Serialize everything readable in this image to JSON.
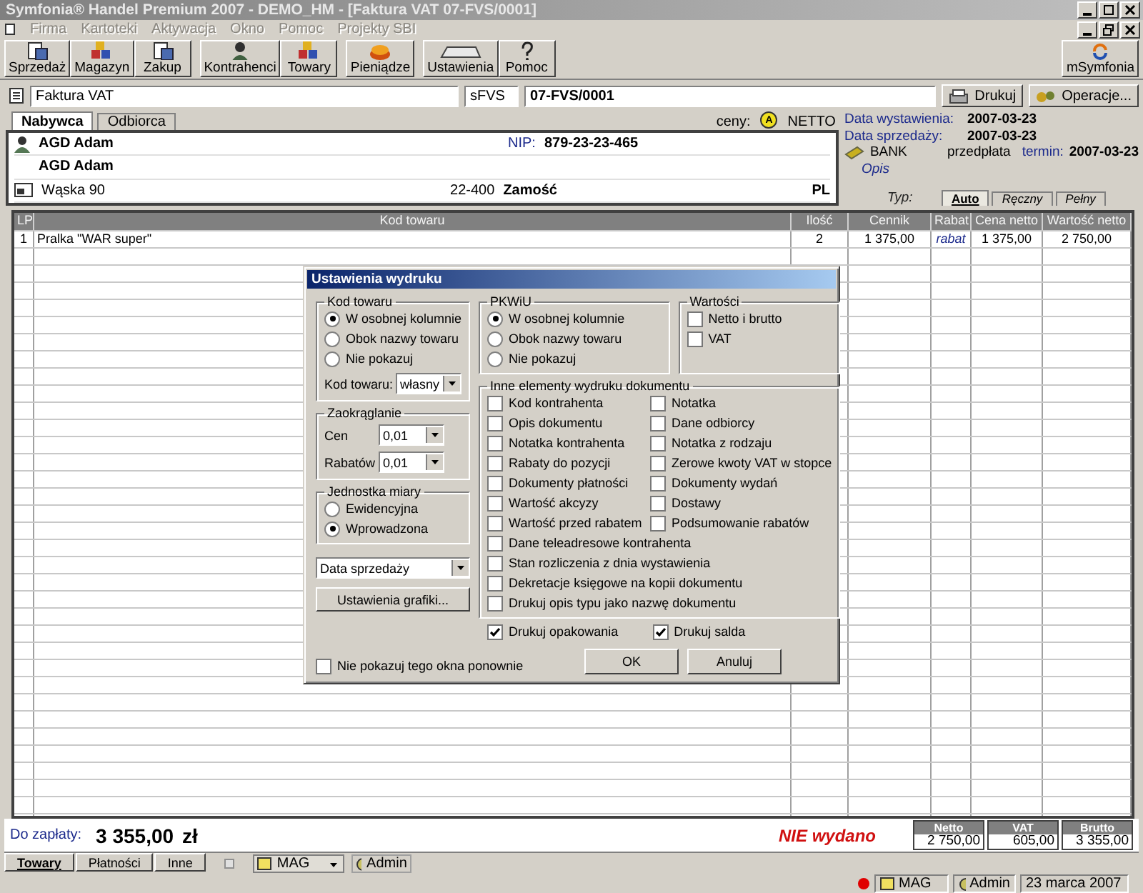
{
  "window": {
    "title": "Symfonia® Handel Premium 2007 - DEMO_HM - [Faktura VAT 07-FVS/0001]"
  },
  "menu": [
    {
      "label": "Firma",
      "disabled": true
    },
    {
      "label": "Kartoteki",
      "disabled": true
    },
    {
      "label": "Aktywacja",
      "disabled": true
    },
    {
      "label": "Okno",
      "disabled": true
    },
    {
      "label": "Pomoc",
      "disabled": true
    },
    {
      "label": "Projekty SBI",
      "disabled": true
    }
  ],
  "toolbar_groups": [
    [
      "Sprzedaż",
      "Magazyn",
      "Zakup"
    ],
    [
      "Kontrahenci",
      "Towary"
    ],
    [
      "Pieniądze"
    ],
    [
      "Ustawienia",
      "Pomoc"
    ]
  ],
  "toolbar_right": "mSymfonia",
  "document": {
    "type": "Faktura VAT",
    "series": "sFVS",
    "number": "07-FVS/0001",
    "print": "Drukuj",
    "operations": "Operacje..."
  },
  "party_tabs": [
    {
      "label": "Nabywca",
      "selected": true
    },
    {
      "label": "Odbiorca",
      "selected": false
    }
  ],
  "prices": {
    "label": "ceny:",
    "badge": "A",
    "mode": "NETTO"
  },
  "customer": {
    "name": "AGD Adam",
    "nip_label": "NIP:",
    "nip": "879-23-23-465",
    "name2": "AGD Adam",
    "street": "Wąska 90",
    "postcode": "22-400",
    "city": "Zamość",
    "country": "PL"
  },
  "dates": [
    {
      "label": "Data wystawienia:",
      "value": "2007-03-23"
    },
    {
      "label": "Data sprzedaży:",
      "value": "2007-03-23"
    }
  ],
  "payment": {
    "method": "BANK",
    "kind": "przedpłata",
    "term_label": "termin:",
    "term": "2007-03-23"
  },
  "description_label": "Opis",
  "type_label": "Typ:",
  "type_tabs": [
    {
      "label": "Auto",
      "selected": true
    },
    {
      "label": "Ręczny",
      "selected": false
    },
    {
      "label": "Pełny",
      "selected": false
    }
  ],
  "table": {
    "columns": [
      "LP",
      "Kod towaru",
      "Ilość",
      "Cennik",
      "Rabat",
      "Cena netto",
      "Wartość netto"
    ],
    "rows": [
      [
        "1",
        "Pralka \"WAR super\"",
        "2",
        "1 375,00",
        "rabat",
        "1 375,00",
        "2 750,00"
      ]
    ]
  },
  "footer": {
    "due_label": "Do zapłaty:",
    "amount": "3 355,00",
    "currency": "zł",
    "status": "NIE wydano",
    "totals": [
      {
        "label": "Netto",
        "value": "2 750,00"
      },
      {
        "label": "VAT",
        "value": "605,00"
      },
      {
        "label": "Brutto",
        "value": "3 355,00"
      }
    ]
  },
  "bottom_tabs": [
    {
      "label": "Towary",
      "selected": true
    },
    {
      "label": "Płatności",
      "selected": false
    },
    {
      "label": "Inne",
      "selected": false
    }
  ],
  "bottom_checkbox": {
    "checked": false
  },
  "bottom_warehouse": "MAG",
  "bottom_user": "Admin",
  "status_bar": {
    "warehouse": "MAG",
    "user": "Admin",
    "date": "23 marca 2007"
  },
  "dialog": {
    "title": "Ustawienia wydruku",
    "product_code": {
      "title": "Kod towaru",
      "options": [
        {
          "label": "W osobnej kolumnie",
          "selected": true
        },
        {
          "label": "Obok nazwy towaru",
          "selected": false
        },
        {
          "label": "Nie pokazuj",
          "selected": false
        }
      ],
      "select_label": "Kod towaru:",
      "select_value": "własny"
    },
    "pkwiu": {
      "title": "PKWiU",
      "options": [
        {
          "label": "W osobnej kolumnie",
          "selected": true
        },
        {
          "label": "Obok nazwy towaru",
          "selected": false
        },
        {
          "label": "Nie pokazuj",
          "selected": false
        }
      ]
    },
    "values": {
      "title": "Wartości",
      "items": [
        {
          "label": "Netto i brutto",
          "checked": false
        },
        {
          "label": "VAT",
          "checked": false
        }
      ]
    },
    "rounding": {
      "title": "Zaokrąglanie",
      "fields": [
        {
          "label": "Cen",
          "value": "0,01"
        },
        {
          "label": "Rabatów",
          "value": "0,01"
        }
      ]
    },
    "other": {
      "title": "Inne elementy wydruku dokumentu",
      "items": [
        {
          "label": "Kod kontrahenta",
          "checked": false
        },
        {
          "label": "Notatka",
          "checked": false
        },
        {
          "label": "Opis dokumentu",
          "checked": false
        },
        {
          "label": "Dane odbiorcy",
          "checked": false
        },
        {
          "label": "Notatka kontrahenta",
          "checked": false
        },
        {
          "label": "Notatka z rodzaju",
          "checked": false
        },
        {
          "label": "Rabaty do pozycji",
          "checked": false
        },
        {
          "label": "Zerowe kwoty VAT w stopce",
          "checked": false
        },
        {
          "label": "Dokumenty płatności",
          "checked": false
        },
        {
          "label": "Dokumenty wydań",
          "checked": false
        },
        {
          "label": "Wartość akcyzy",
          "checked": false
        },
        {
          "label": "Dostawy",
          "checked": false
        },
        {
          "label": "Wartość przed rabatem",
          "checked": false
        },
        {
          "label": "Podsumowanie rabatów",
          "checked": false
        }
      ],
      "wide_items": [
        {
          "label": "Dane teleadresowe kontrahenta",
          "checked": false
        },
        {
          "label": "Stan rozliczenia z dnia wystawienia",
          "checked": false
        },
        {
          "label": "Dekretacje księgowe na kopii dokumentu",
          "checked": false
        },
        {
          "label": "Drukuj opis typu jako nazwę dokumentu",
          "checked": false
        }
      ]
    },
    "unit": {
      "title": "Jednostka miary",
      "options": [
        {
          "label": "Ewidencyjna",
          "selected": false
        },
        {
          "label": "Wprowadzona",
          "selected": true
        }
      ]
    },
    "date_select": "Data sprzedaży",
    "graphics_button": "Ustawienia grafiki...",
    "print_options": [
      {
        "label": "Drukuj opakowania",
        "checked": true
      },
      {
        "label": "Drukuj salda",
        "checked": true
      }
    ],
    "dont_show": {
      "label": "Nie pokazuj tego okna ponownie",
      "checked": false
    },
    "ok": "OK",
    "cancel": "Anuluj"
  }
}
